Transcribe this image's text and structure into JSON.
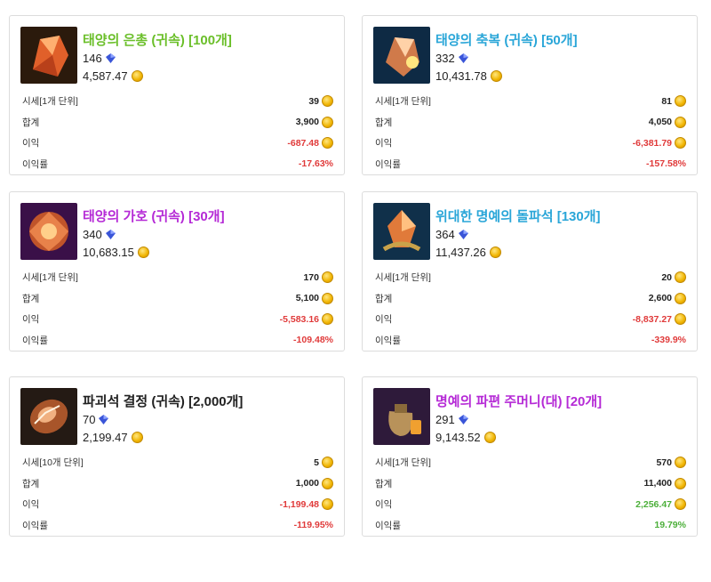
{
  "colors": {
    "green": "#6bbf2a",
    "blue": "#2aa6d8",
    "purple": "#b52ad6",
    "black": "#222222",
    "negative": "#e03a3a",
    "positive": "#4caf3a"
  },
  "cards": [
    {
      "title": "태양의 은총 (귀속) [100개]",
      "title_color": "green",
      "crystal": "146",
      "gold": "4,587.47",
      "rows": [
        {
          "label": "시세[1개 단위]",
          "value": "39"
        },
        {
          "label": "합계",
          "value": "3,900"
        },
        {
          "label": "이익",
          "value": "-687.48"
        },
        {
          "label": "이익률",
          "value": "-17.63%"
        }
      ],
      "icon": "sun-grace-icon"
    },
    {
      "title": "태양의 축복 (귀속) [50개]",
      "title_color": "blue",
      "crystal": "332",
      "gold": "10,431.78",
      "rows": [
        {
          "label": "시세[1개 단위]",
          "value": "81"
        },
        {
          "label": "합계",
          "value": "4,050"
        },
        {
          "label": "이익",
          "value": "-6,381.79"
        },
        {
          "label": "이익률",
          "value": "-157.58%"
        }
      ],
      "icon": "sun-blessing-icon"
    },
    {
      "title": "태양의 가호 (귀속) [30개]",
      "title_color": "purple",
      "crystal": "340",
      "gold": "10,683.15",
      "rows": [
        {
          "label": "시세[1개 단위]",
          "value": "170"
        },
        {
          "label": "합계",
          "value": "5,100"
        },
        {
          "label": "이익",
          "value": "-5,583.16"
        },
        {
          "label": "이익률",
          "value": "-109.48%"
        }
      ],
      "icon": "sun-protection-icon"
    },
    {
      "title": "위대한 명예의 돌파석 [130개]",
      "title_color": "blue",
      "crystal": "364",
      "gold": "11,437.26",
      "rows": [
        {
          "label": "시세[1개 단위]",
          "value": "20"
        },
        {
          "label": "합계",
          "value": "2,600"
        },
        {
          "label": "이익",
          "value": "-8,837.27"
        },
        {
          "label": "이익률",
          "value": "-339.9%"
        }
      ],
      "icon": "honor-breakthrough-icon"
    },
    {
      "title": "파괴석 결정 (귀속) [2,000개]",
      "title_color": "black",
      "crystal": "70",
      "gold": "2,199.47",
      "rows": [
        {
          "label": "시세[10개 단위]",
          "value": "5"
        },
        {
          "label": "합계",
          "value": "1,000"
        },
        {
          "label": "이익",
          "value": "-1,199.48"
        },
        {
          "label": "이익률",
          "value": "-119.95%"
        }
      ],
      "icon": "destruction-crystal-icon"
    },
    {
      "title": "명예의 파편 주머니(대) [20개]",
      "title_color": "purple",
      "crystal": "291",
      "gold": "9,143.52",
      "rows": [
        {
          "label": "시세[1개 단위]",
          "value": "570"
        },
        {
          "label": "합계",
          "value": "11,400"
        },
        {
          "label": "이익",
          "value": "2,256.47"
        },
        {
          "label": "이익률",
          "value": "19.79%"
        }
      ],
      "icon": "honor-shard-pouch-icon"
    }
  ]
}
